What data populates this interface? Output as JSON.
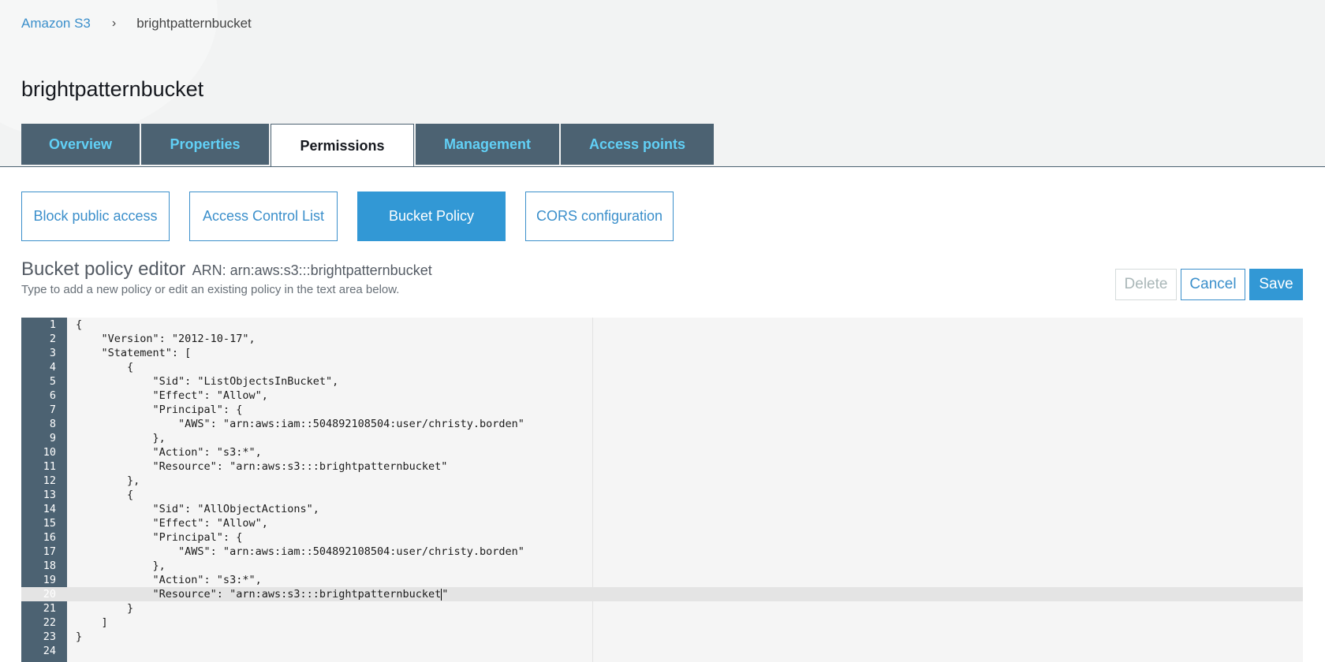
{
  "breadcrumb": {
    "root_label": "Amazon S3",
    "separator": "›",
    "current_label": "brightpatternbucket"
  },
  "page_title": "brightpatternbucket",
  "tabs": [
    {
      "label": "Overview",
      "active": false
    },
    {
      "label": "Properties",
      "active": false
    },
    {
      "label": "Permissions",
      "active": true
    },
    {
      "label": "Management",
      "active": false
    },
    {
      "label": "Access points",
      "active": false
    }
  ],
  "subtabs": [
    {
      "label": "Block public access",
      "active": false
    },
    {
      "label": "Access Control List",
      "active": false
    },
    {
      "label": "Bucket Policy",
      "active": true
    },
    {
      "label": "CORS configuration",
      "active": false
    }
  ],
  "editor": {
    "title": "Bucket policy editor",
    "arn": "ARN: arn:aws:s3:::brightpatternbucket",
    "hint": "Type to add a new policy or edit an existing policy in the text area below.",
    "current_line": 20,
    "lines": [
      "{",
      "    \"Version\": \"2012-10-17\",",
      "    \"Statement\": [",
      "        {",
      "            \"Sid\": \"ListObjectsInBucket\",",
      "            \"Effect\": \"Allow\",",
      "            \"Principal\": {",
      "                \"AWS\": \"arn:aws:iam::504892108504:user/christy.borden\"",
      "            },",
      "            \"Action\": \"s3:*\",",
      "            \"Resource\": \"arn:aws:s3:::brightpatternbucket\"",
      "        },",
      "        {",
      "            \"Sid\": \"AllObjectActions\",",
      "            \"Effect\": \"Allow\",",
      "            \"Principal\": {",
      "                \"AWS\": \"arn:aws:iam::504892108504:user/christy.borden\"",
      "            },",
      "            \"Action\": \"s3:*\",",
      "            \"Resource\": \"arn:aws:s3:::brightpatternbucket\"",
      "        }",
      "    ]",
      "}",
      ""
    ]
  },
  "actions": {
    "delete_label": "Delete",
    "cancel_label": "Cancel",
    "save_label": "Save"
  },
  "colors": {
    "tab_bg": "#4c6272",
    "tab_text": "#61d0f6",
    "link": "#3b8fcb",
    "primary_button": "#3298d5"
  }
}
